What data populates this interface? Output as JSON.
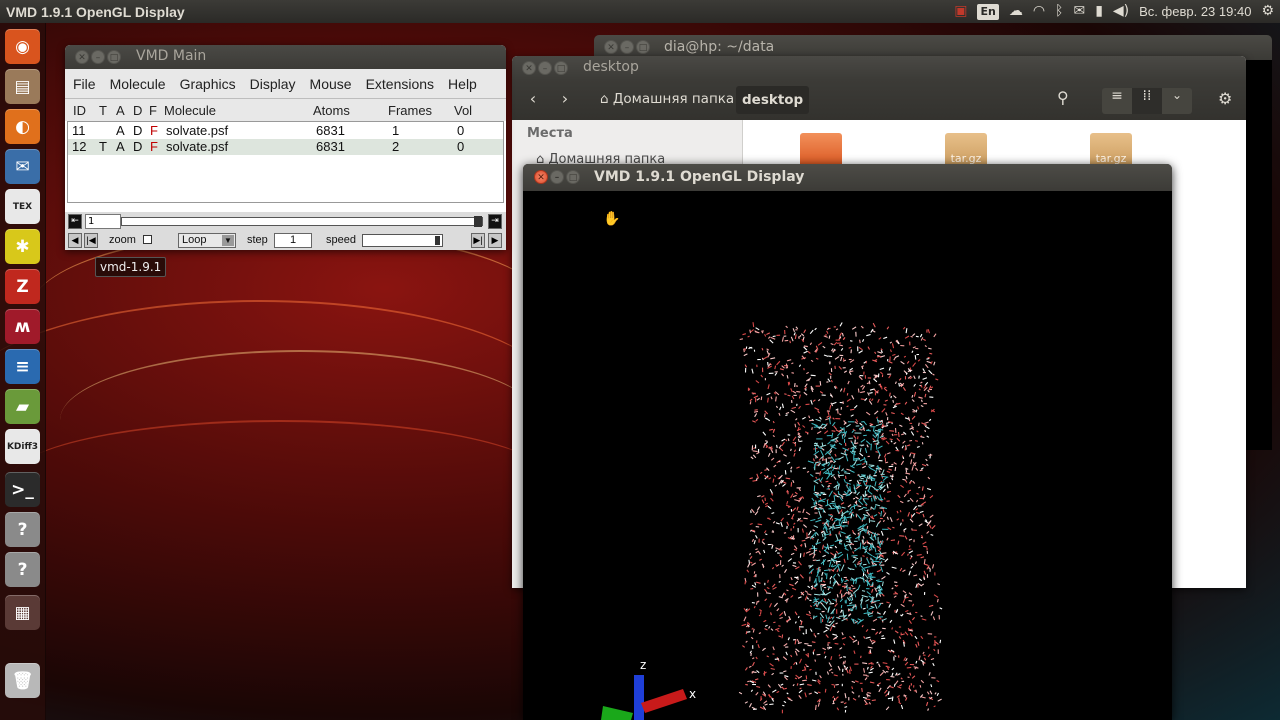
{
  "top_panel": {
    "title": "VMD 1.9.1 OpenGL Display",
    "lang": "En",
    "clock": "Вс. февр. 23  19:40",
    "icons": [
      "record-icon",
      "cloud-icon",
      "wifi-icon",
      "mail-icon",
      "bluetooth-icon",
      "battery-icon",
      "volume-icon",
      "gear-icon"
    ]
  },
  "launcher": {
    "items": [
      {
        "name": "ubuntu-dash",
        "glyph": "◉",
        "color": "#d9541e"
      },
      {
        "name": "files-manager",
        "glyph": "▤",
        "color": "#9a7a5a"
      },
      {
        "name": "firefox",
        "glyph": "◐",
        "color": "#e0701c"
      },
      {
        "name": "thunderbird",
        "glyph": "✉",
        "color": "#3a6ea8"
      },
      {
        "name": "texmaker",
        "glyph": "TEX",
        "color": "#e8e8e8"
      },
      {
        "name": "game-app",
        "glyph": "✱",
        "color": "#d8c81a"
      },
      {
        "name": "zotero",
        "glyph": "Z",
        "color": "#c0281e"
      },
      {
        "name": "mendeley",
        "glyph": "ʍ",
        "color": "#a01a2a"
      },
      {
        "name": "libreoffice-writer",
        "glyph": "≡",
        "color": "#2a6ab0"
      },
      {
        "name": "book-app",
        "glyph": "▰",
        "color": "#6a9a3a"
      },
      {
        "name": "kdiff3",
        "glyph": "KDiff3",
        "color": "#e8e8e8"
      },
      {
        "name": "terminal",
        "glyph": ">_",
        "color": "#2b2b2b"
      },
      {
        "name": "unknown-app-1",
        "glyph": "?",
        "color": "#8a8a8a"
      },
      {
        "name": "unknown-app-2",
        "glyph": "?",
        "color": "#8a8a8a"
      },
      {
        "name": "workspace-switcher",
        "glyph": "▦",
        "color": "#5a3a36"
      },
      {
        "name": "trash",
        "glyph": "🗑",
        "color": "#b8b8b8"
      }
    ]
  },
  "terminal_window": {
    "title": "dia@hp: ~/data"
  },
  "file_manager": {
    "title": "desktop",
    "breadcrumb_home": "Домашняя папка",
    "breadcrumb_current": "desktop",
    "places_title": "Места",
    "places_home": "Домашняя папка",
    "files": [
      "",
      "tar.gz",
      "tar.gz"
    ]
  },
  "vmd_main": {
    "title": "VMD Main",
    "menu": [
      "File",
      "Molecule",
      "Graphics",
      "Display",
      "Mouse",
      "Extensions",
      "Help"
    ],
    "columns": {
      "id": "ID",
      "t": "T",
      "a": "A",
      "d": "D",
      "f": "F",
      "molecule": "Molecule",
      "atoms": "Atoms",
      "frames": "Frames",
      "vol": "Vol"
    },
    "rows": [
      {
        "id": "11",
        "t": "",
        "a": "A",
        "d": "D",
        "f": "F",
        "molecule": "solvate.psf",
        "atoms": "6831",
        "frames": "1",
        "vol": "0"
      },
      {
        "id": "12",
        "t": "T",
        "a": "A",
        "d": "D",
        "f": "F",
        "molecule": "solvate.psf",
        "atoms": "6831",
        "frames": "2",
        "vol": "0"
      }
    ],
    "frame_value": "1",
    "zoom_label": "zoom",
    "loop_value": "Loop",
    "step_label": "step",
    "step_value": "1",
    "speed_label": "speed"
  },
  "tooltip": "vmd-1.9.1",
  "gl_display": {
    "title": "VMD 1.9.1 OpenGL Display",
    "axes": {
      "z": "z",
      "x": "x"
    }
  }
}
